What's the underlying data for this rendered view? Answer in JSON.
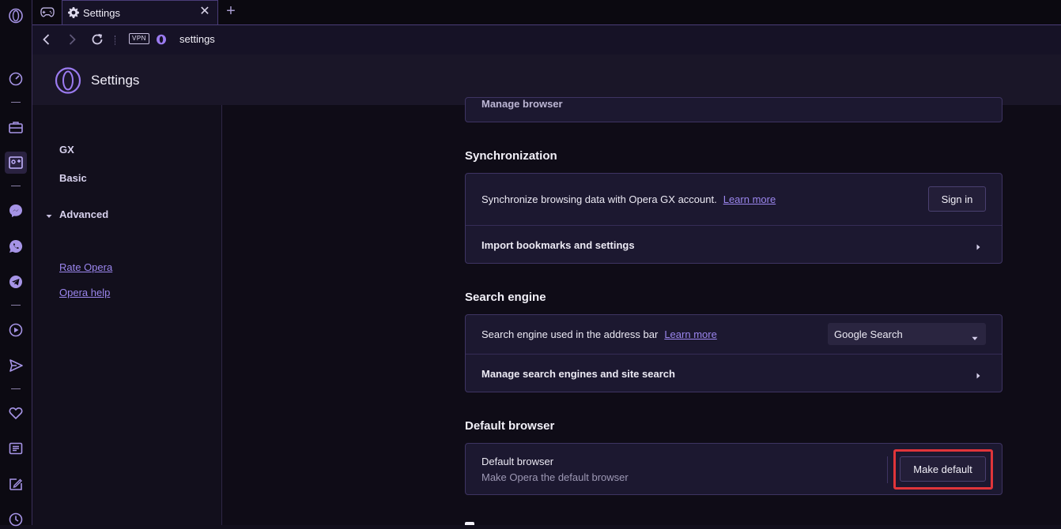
{
  "tab": {
    "title": "Settings"
  },
  "address": {
    "vpn_label": "VPN",
    "url": "settings"
  },
  "header": {
    "title": "Settings"
  },
  "sidebar": {
    "items": [
      {
        "label": "GX"
      },
      {
        "label": "Basic"
      },
      {
        "label": "Advanced"
      }
    ],
    "links": [
      {
        "label": "Rate Opera"
      },
      {
        "label": "Opera help"
      }
    ]
  },
  "main": {
    "top_card_partial": "Manage browser",
    "sync": {
      "title": "Synchronization",
      "desc": "Synchronize browsing data with Opera GX account.",
      "learn_more": "Learn more",
      "sign_in": "Sign in",
      "import": "Import bookmarks and settings"
    },
    "search": {
      "title": "Search engine",
      "desc": "Search engine used in the address bar",
      "learn_more": "Learn more",
      "selected": "Google Search",
      "manage": "Manage search engines and site search"
    },
    "default_browser": {
      "title": "Default browser",
      "row_title": "Default browser",
      "row_sub": "Make Opera the default browser",
      "button": "Make default"
    }
  },
  "colors": {
    "accent": "#9b86ee",
    "highlight": "#e0353a",
    "panel": "#1c1830"
  },
  "icons": {
    "rail": [
      "opera-logo-icon",
      "speed-dial-icon",
      "briefcase-icon",
      "gx-corner-icon",
      "messenger-icon",
      "whatsapp-icon",
      "telegram-icon",
      "player-icon",
      "send-icon",
      "heart-icon",
      "news-icon",
      "pinboard-icon",
      "history-icon"
    ]
  }
}
